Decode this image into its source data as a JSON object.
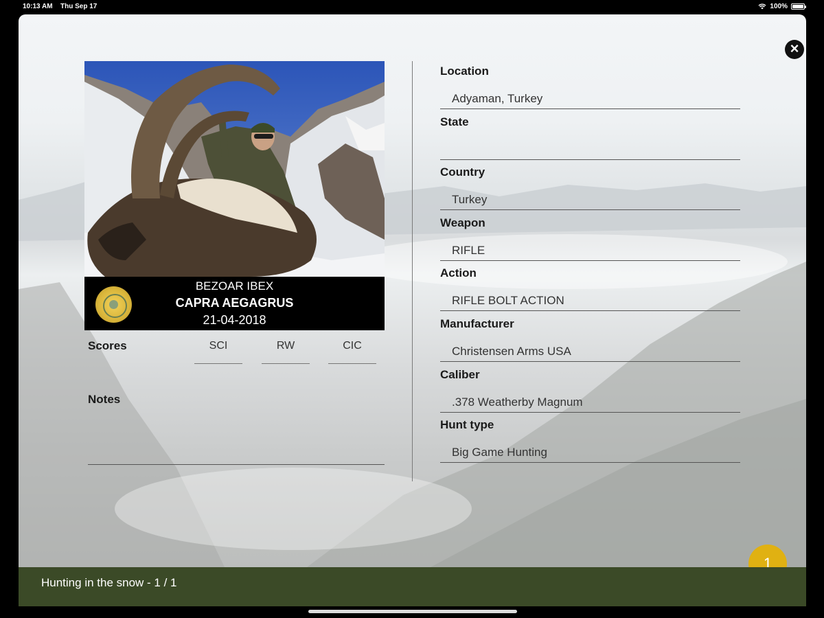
{
  "status_bar": {
    "time": "10:13 AM",
    "date": "Thu Sep 17",
    "battery": "100%"
  },
  "close_icon": "close-circle-icon",
  "trophy": {
    "common_name": "BEZOAR IBEX",
    "scientific_name": "CAPRA AEGAGRUS",
    "date": "21-04-2018",
    "medal_icon": "gold-medal-icon"
  },
  "scores": {
    "label": "Scores",
    "columns": [
      "SCI",
      "RW",
      "CIC"
    ]
  },
  "notes": {
    "label": "Notes"
  },
  "fields": [
    {
      "label": "Location",
      "value": "Adyaman, Turkey"
    },
    {
      "label": "State",
      "value": ""
    },
    {
      "label": "Country",
      "value": "Turkey"
    },
    {
      "label": "Weapon",
      "value": "RIFLE"
    },
    {
      "label": "Action",
      "value": "RIFLE BOLT ACTION"
    },
    {
      "label": "Manufacturer",
      "value": "Christensen Arms USA"
    },
    {
      "label": "Caliber",
      "value": ".378 Weatherby Magnum"
    },
    {
      "label": "Hunt type",
      "value": "Big Game Hunting"
    }
  ],
  "page_badge": "1",
  "footer": {
    "text": "Hunting in the snow - 1 / 1"
  },
  "colors": {
    "footer_bg": "#3b4a27",
    "badge_bg": "#e0b112"
  }
}
